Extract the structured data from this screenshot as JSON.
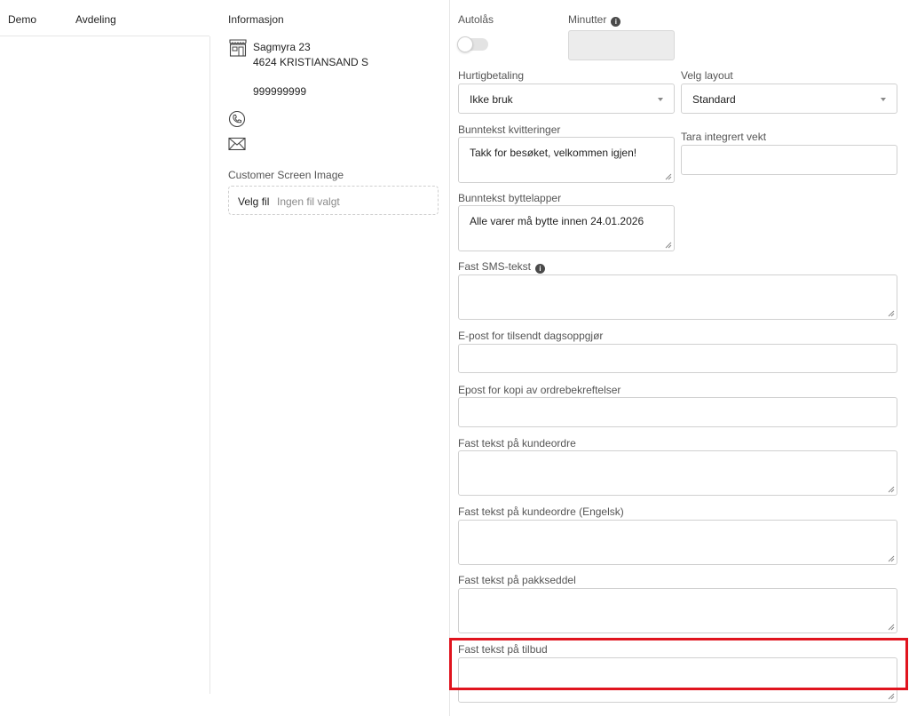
{
  "left": {
    "col_demo": "Demo",
    "col_avdeling": "Avdeling"
  },
  "info": {
    "title": "Informasjon",
    "address_line1": "Sagmyra 23",
    "address_line2": "4624 KRISTIANSAND S",
    "phone": "999999999",
    "store_icon": "store-icon",
    "phone_icon": "phone-icon",
    "mail_icon": "mail-icon",
    "customer_screen_label": "Customer Screen Image",
    "file_button": "Velg fil",
    "file_status": "Ingen fil valgt"
  },
  "settings": {
    "autolas_label": "Autolås",
    "autolas_on": false,
    "minutter_label": "Minutter",
    "minutter_value": "",
    "hurtigbetaling_label": "Hurtigbetaling",
    "hurtigbetaling_value": "Ikke bruk",
    "layout_label": "Velg layout",
    "layout_value": "Standard",
    "bunntekst_kvitteringer_label": "Bunntekst kvitteringer",
    "bunntekst_kvitteringer_value": "Takk for besøket, velkommen igjen!",
    "tara_label": "Tara integrert vekt",
    "tara_value": "",
    "bunntekst_bytte_label": "Bunntekst byttelapper",
    "bunntekst_bytte_value": "Alle varer må bytte innen 24.01.2026",
    "sms_label": "Fast SMS-tekst",
    "sms_value": "",
    "epost_dagsoppgjor_label": "E-post for tilsendt dagsoppgjør",
    "epost_dagsoppgjor_value": "",
    "epost_ordre_label": "Epost for kopi av ordrebekreftelser",
    "epost_ordre_value": "",
    "kundeordre_label": "Fast tekst på kundeordre",
    "kundeordre_value": "",
    "kundeordre_en_label": "Fast tekst på kundeordre (Engelsk)",
    "kundeordre_en_value": "",
    "pakkseddel_label": "Fast tekst på pakkseddel",
    "pakkseddel_value": "",
    "tilbud_label": "Fast tekst på tilbud",
    "tilbud_value": "",
    "info_glyph": "i"
  },
  "colors": {
    "highlight": "#e0141e",
    "input_border": "#d0d0d0",
    "disabled_bg": "#ececec"
  }
}
